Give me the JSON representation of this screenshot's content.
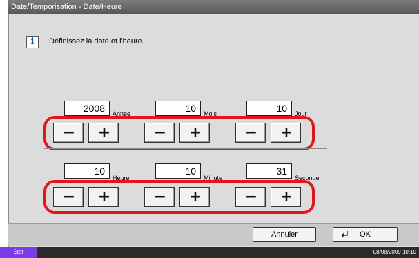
{
  "window": {
    "title": "Date/Temporisation - Date/Heure"
  },
  "message": {
    "icon": "info-icon",
    "text": "Définissez la date et l'heure."
  },
  "date_fields": [
    {
      "value": "2008",
      "unit": "Année"
    },
    {
      "value": "10",
      "unit": "Mois"
    },
    {
      "value": "10",
      "unit": "Jour"
    }
  ],
  "time_fields": [
    {
      "value": "10",
      "unit": "Heure"
    },
    {
      "value": "10",
      "unit": "Minute"
    },
    {
      "value": "31",
      "unit": "Seconde"
    }
  ],
  "stepper": {
    "minus": "−",
    "plus": "+"
  },
  "footer": {
    "cancel": "Annuler",
    "ok": "OK",
    "ok_icon": "enter-icon"
  },
  "status": {
    "label": "État",
    "datetime": "08/08/2009   10:10"
  },
  "colors": {
    "highlight": "#e2161d",
    "status_accent": "#7b3ce6"
  }
}
